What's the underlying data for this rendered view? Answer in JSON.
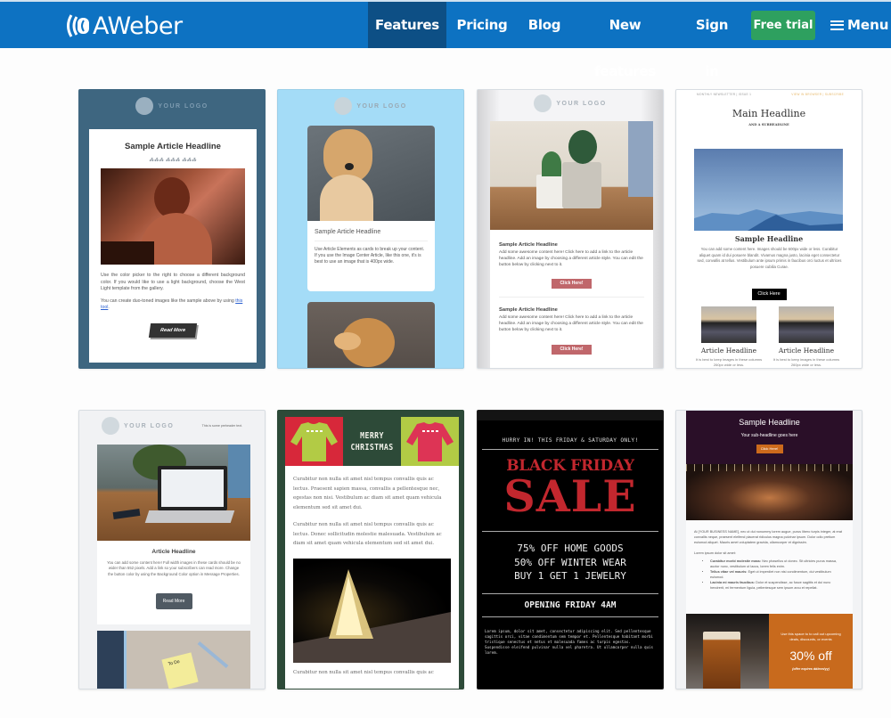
{
  "nav": {
    "brand": "AWeber",
    "items": [
      {
        "label": "Features",
        "active": true
      },
      {
        "label": "Pricing"
      },
      {
        "label": "Blog"
      },
      {
        "label": "New features"
      },
      {
        "label": "Sign in"
      }
    ],
    "cta": "Free trial",
    "menu": "Menu",
    "colors": {
      "bar": "#0d72c2",
      "active": "#0d4f85",
      "cta": "#2ea05f"
    }
  },
  "templates": [
    {
      "logo": "YOUR LOGO",
      "headline": "Sample Article Headline",
      "p1": "Use the color picker to the right to choose a different background color. If you would like to use a light background, choose the West Light template from the gallery.",
      "p2_pre": "You can create duo-toned images like the sample above by using ",
      "p2_link": "this tool",
      "p2_post": ".",
      "button": "Read More"
    },
    {
      "logo": "YOUR LOGO",
      "headline": "Sample Article Headline",
      "body": "Use Article Elements as cards to break up your content. If you use the Image Center Article, like this one, it's is best to use an image that is 400px wide."
    },
    {
      "logo": "YOUR LOGO",
      "articles": [
        {
          "headline": "Sample Article Headline",
          "body": "Add some awesome content here! Click here to add a link to the article headline. Add an image by choosing a different article style. You can edit the button below by clicking next to it.",
          "button": "Click Here!"
        },
        {
          "headline": "Sample Article Headline",
          "body": "Add some awesome content here! Click here to add a link to the article headline. Add an image by choosing a different article style. You can edit the button below by clicking next to it.",
          "button": "Click Here!"
        }
      ]
    },
    {
      "topleft": "MONTHLY NEWSLETTER | ISSUE 1",
      "topright": "VIEW IN BROWSER | SUBSCRIBE",
      "headline": "Main Headline",
      "subheadline": "AND A SUBHEADLINE",
      "sample": "Sample Headline",
      "body": "You can add some content here. Images should be 600px wide or less. Curabitur aliquet quam id dui posuere blandit. Vivamus magna justo, lacinia eget consectetur sed, convallis at tellus. Vestibulum ante ipsum primis in faucibus orci luctus et ultrices posuere cubilia Curae.",
      "button": "Click Here",
      "columns": [
        {
          "headline": "Article Headline",
          "body": "It is best to keep images in these columns 260px wide or less."
        },
        {
          "headline": "Article Headline",
          "body": "It is best to keep images in these columns 260px wide or less."
        }
      ]
    },
    {
      "logo": "YOUR LOGO",
      "preheader": "This is some preheader text.",
      "headline": "Article Headline",
      "body": "You can add some content here! Full width images in these cards should be no wider than 552 pixels. Add a link so your subscribers can read more. Change the button color by using the Background Color option in Message Properties.",
      "button": "Read More",
      "note": "To Do"
    },
    {
      "title1": "MERRY",
      "title2": "CHRISTMAS",
      "p1": "Curabitur non nulla sit amet nisl tempus convallis quis ac lectus. Praesent sapien massa, convallis a pellentesque nec, egestas non nisi. Vestibulum ac diam sit amet quam vehicula elementum sed sit amet dui.",
      "p2": "Curabitur non nulla sit amet nisl tempus convallis quis ac lectus. Donec sollicitudin molestie malesuada. Vestibulum ac diam sit amet quam vehicula elementum sed sit amet dui.",
      "p3": "Curabitur non nulla sit amet nisl tempus convallis quis ac"
    },
    {
      "top": "HURRY IN! THIS FRIDAY & SATURDAY ONLY!",
      "title1": "BLACK FRIDAY",
      "title2": "SALE",
      "deals": [
        "75% OFF HOME GOODS",
        "50% OFF WINTER WEAR",
        "BUY 1 GET 1 JEWELRY"
      ],
      "opening": "OPENING FRIDAY 4AM",
      "body": "Lorem ipsum, dolor sit amet, consectetur adipiscing elit. Sed pellentesque sagittis orci, vitae condimentum sem tempor et. Pellentesque habitant morbi tristique senectus et netus et malesuada fames ac turpis egestas. Suspendisse eleifend pulvinar nulla vel pharetra. Ut ullamcorper nulla quis lorem."
    },
    {
      "headline": "Sample Headline",
      "sub": "Your sub-headline goes here",
      "button": "Click Here!",
      "body": "At [YOUR BUSINESS NAME], nec ut dui nonummy lorem augue, purus libero turpis integer, at erat convallis neque, praesent eleifend placerat ridiculus magna pulvinar ipsum. Dolor odio pretium euismod aliquet. Mauris amet voluptatem gravida, ullamcorper et dignissim.",
      "lead": "Lorem ipsum dolor sit amet:",
      "bullets": [
        {
          "b": "Curabitur morbi molestie mass:",
          "t": " Nec phasellus ut donec. Sit ultricies purus massa, auctor nunc, vestibulum ut lacus, lorem felis enim."
        },
        {
          "b": "Tellus vitae vel mauris:",
          "t": " Eget ut imperdiet non nisi condimentum, dui vestibulum euismod."
        },
        {
          "b": "Lacinia mi mauris faucibus:",
          "t": " Dolor et suspendisse, ac fusce sagittis et dui nunc hendrerit, mi fermentum ligula, pellentesque sem ipsum arcu et repellat."
        }
      ],
      "promo": "Use this space to to call out upcoming deals, discounts, or events",
      "discount": "30% off",
      "fine": "(offer expires dd/mm/yy)"
    }
  ]
}
